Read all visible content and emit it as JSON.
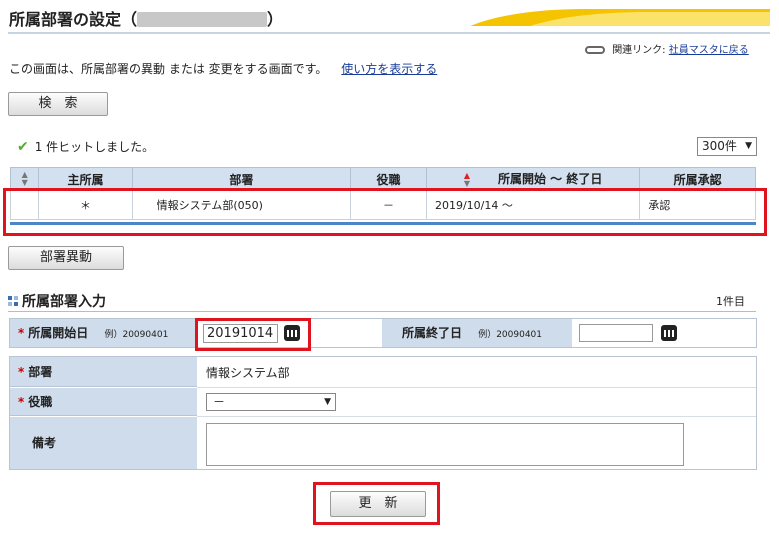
{
  "header": {
    "title": "所属部署の設定（",
    "title_close": "）"
  },
  "related": {
    "label": "関連リンク:",
    "link": "社員マスタに戻る"
  },
  "intro": {
    "text": "この画面は、所属部署の異動 または 変更をする画面です。",
    "help_link": "使い方を表示する"
  },
  "search_button": "検　索",
  "hit": {
    "text": "1 件ヒットしました。"
  },
  "per_page": {
    "selected": "300件"
  },
  "table": {
    "headers": [
      "主所属",
      "部署",
      "役職",
      "所属開始 ～ 終了日",
      "所属承認"
    ],
    "row": {
      "main": "＊",
      "dept": "情報システム部(050)",
      "role": "－",
      "period": "2019/10/14 ～",
      "approval": "承認"
    }
  },
  "transfer_button": "部署異動",
  "section": {
    "title": "所属部署入力",
    "count": "1件目"
  },
  "form": {
    "start_label": "所属開始日",
    "start_example": "例）20090401",
    "start_value": "20191014",
    "end_label": "所属終了日",
    "end_example": "例）20090401",
    "end_value": "",
    "dept_label": "部署",
    "dept_value": "情報システム部",
    "role_label": "役職",
    "role_value": "－",
    "note_label": "備考",
    "note_value": ""
  },
  "update_button": "更　新",
  "colors": {
    "accent_yellow": "#f5c400",
    "header_blue": "#d3e0ef",
    "highlight_red": "#e0141f",
    "link_blue": "#1a3c99"
  }
}
